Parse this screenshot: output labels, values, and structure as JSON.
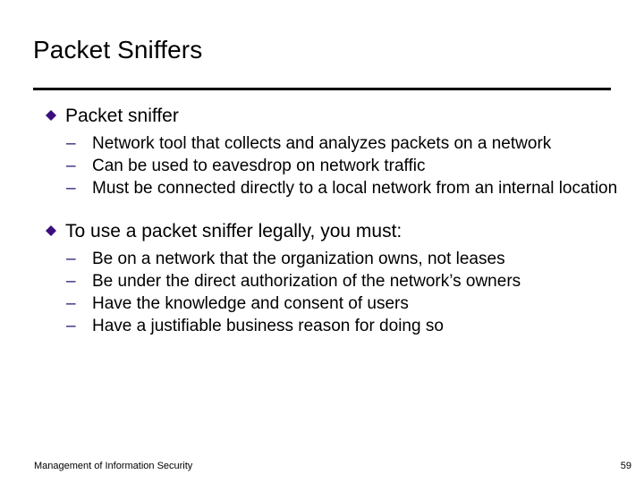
{
  "slide": {
    "title": "Packet Sniffers",
    "page_number": "59",
    "footer_text": "Management of Information Security",
    "accent_color": "#3A0F7D",
    "dash_color": "#2E1A6E",
    "text_color": "#000000",
    "background_color": "#FFFFFF",
    "rule_color": "#000000",
    "bullet_glyph_name": "diamond-bullet",
    "dash_glyph": "–",
    "sections": [
      {
        "heading": "Packet sniffer",
        "items": [
          "Network tool that collects and analyzes packets on a network",
          "Can be used to eavesdrop on network traffic",
          "Must be connected directly to a local network from an internal location"
        ]
      },
      {
        "heading": "To use a packet sniffer legally, you must:",
        "items": [
          "Be on a network that the organization owns, not leases",
          "Be under the direct authorization of the network’s owners",
          "Have the knowledge and consent of users",
          "Have a justifiable business reason for doing so"
        ]
      }
    ]
  }
}
